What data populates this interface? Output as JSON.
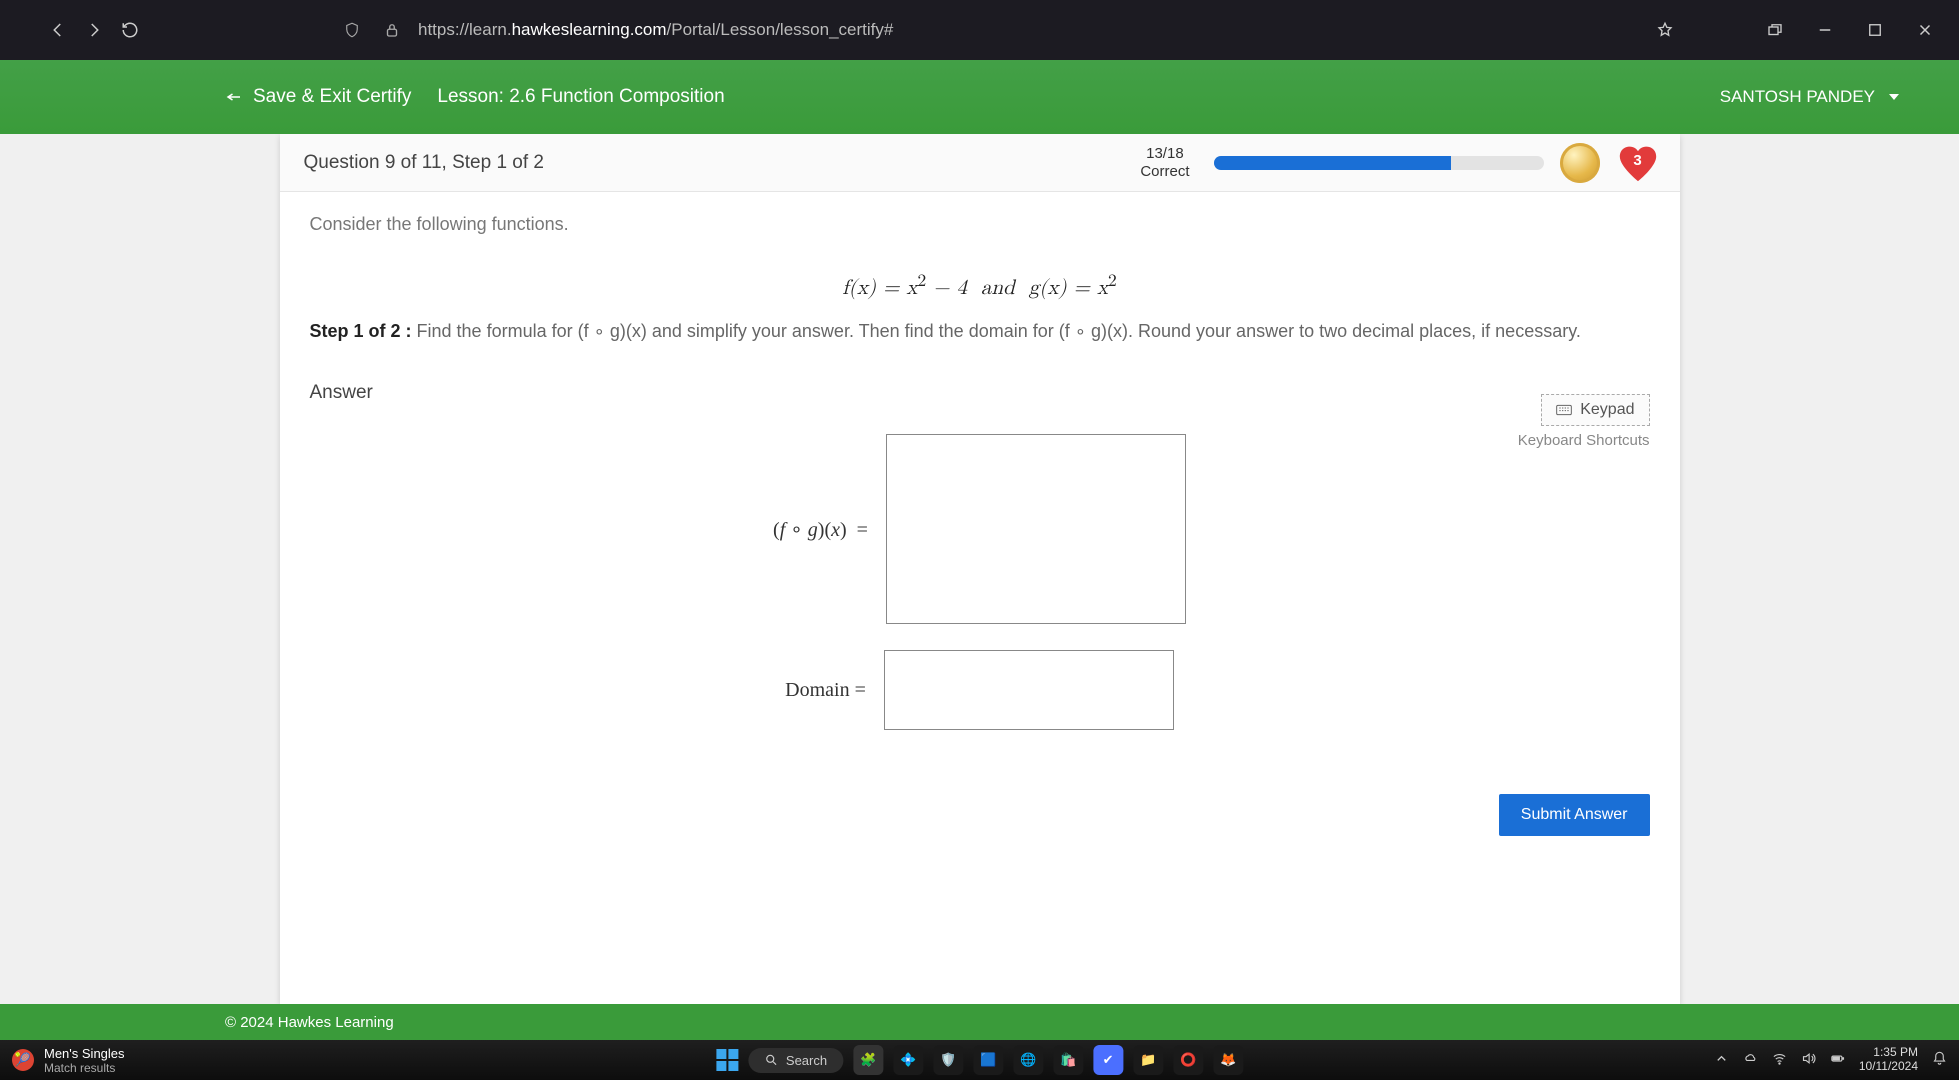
{
  "browser": {
    "url_prefix": "https://learn.",
    "url_host": "hawkeslearning.com",
    "url_path": "/Portal/Lesson/lesson_certify#"
  },
  "header": {
    "save_exit": "Save & Exit Certify",
    "lesson": "Lesson: 2.6 Function Composition",
    "user": "SANTOSH PANDEY"
  },
  "question": {
    "title": "Question 9 of 11, Step 1 of 2",
    "score": "13/18",
    "score_label": "Correct",
    "progress_pct": 72,
    "hearts": "3",
    "consider": "Consider the following functions.",
    "math": "f(x) = x² − 4  and  g(x) = x²",
    "step_label": "Step 1 of 2 :",
    "step_text": "Find the formula for (f ∘ g)(x) and simplify your answer. Then find the domain for (f ∘ g)(x). Round your answer to two decimal places, if necessary.",
    "answer_label": "Answer",
    "keypad": "Keypad",
    "shortcuts": "Keyboard Shortcuts",
    "fog_label": "(f ∘ g)(x)  =",
    "domain_label": "Domain  =",
    "submit": "Submit Answer"
  },
  "footer": {
    "copyright": "© 2024 Hawkes Learning"
  },
  "taskbar": {
    "news_title": "Men's Singles",
    "news_sub": "Match results",
    "search": "Search",
    "time": "1:35 PM",
    "date": "10/11/2024"
  }
}
